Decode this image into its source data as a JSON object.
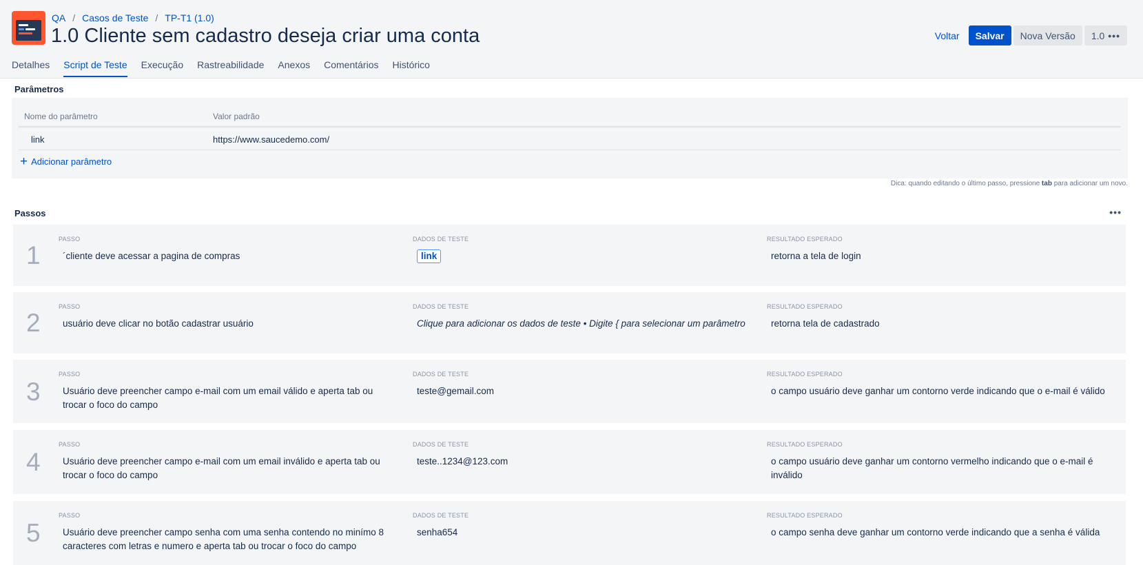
{
  "breadcrumb": {
    "project": "QA",
    "folder": "Casos de Teste",
    "test_case": "TP-T1 (1.0)",
    "separator": "/"
  },
  "title": "1.0 Cliente sem cadastro deseja criar uma conta",
  "actions": {
    "back": "Voltar",
    "save": "Salvar",
    "new_version": "Nova Versão",
    "version": "1.0",
    "more": "•••"
  },
  "tabs": [
    {
      "label": "Detalhes"
    },
    {
      "label": "Script de Teste",
      "active": true
    },
    {
      "label": "Execução"
    },
    {
      "label": "Rastreabilidade"
    },
    {
      "label": "Anexos"
    },
    {
      "label": "Comentários"
    },
    {
      "label": "Histórico"
    }
  ],
  "parameters": {
    "title": "Parâmetros",
    "col_name": "Nome do parâmetro",
    "col_default": "Valor padrão",
    "rows": [
      {
        "name": "link",
        "default": "https://www.saucedemo.com/"
      }
    ],
    "add_label": "Adicionar parâmetro",
    "add_icon": "+"
  },
  "tip": {
    "prefix": "Dica: quando editando o último passo, pressione",
    "key": "tab",
    "suffix": "para adicionar um novo."
  },
  "steps": {
    "title": "Passos",
    "more": "•••",
    "label_step": "PASSO",
    "label_data": "DADOS DE TESTE",
    "label_result": "RESULTADO ESPERADO",
    "data_placeholder": "Clique para adicionar os dados de teste • Digite { para selecionar um parâmetro",
    "items": [
      {
        "number": "1",
        "step": "´cliente deve acessar a pagina de compras",
        "data_param": "link",
        "result": "retorna a tela de login"
      },
      {
        "number": "2",
        "step": "usuário deve clicar no botão cadastrar usuário",
        "result": "retorna tela de cadastrado"
      },
      {
        "number": "3",
        "step": "Usuário deve preencher campo e-mail com um email válido e aperta tab ou trocar o foco do campo",
        "data": "teste@gemail.com",
        "result": "o campo usuário deve ganhar um contorno verde indicando que o e-mail é válido"
      },
      {
        "number": "4",
        "step": "Usuário deve preencher campo e-mail com um email inválido e aperta tab ou trocar o foco do campo",
        "data": "teste..1234@123.com",
        "result": "o campo usuário deve ganhar um contorno vermelho indicando que o e-mail é inválido"
      },
      {
        "number": "5",
        "step": "Usuário deve preencher campo senha com uma senha contendo no minímo 8 caracteres com letras e numero e aperta tab ou trocar o foco do campo",
        "data": "senha654",
        "result": "o campo senha deve ganhar um contorno verde indicando que a senha é válida"
      }
    ]
  }
}
